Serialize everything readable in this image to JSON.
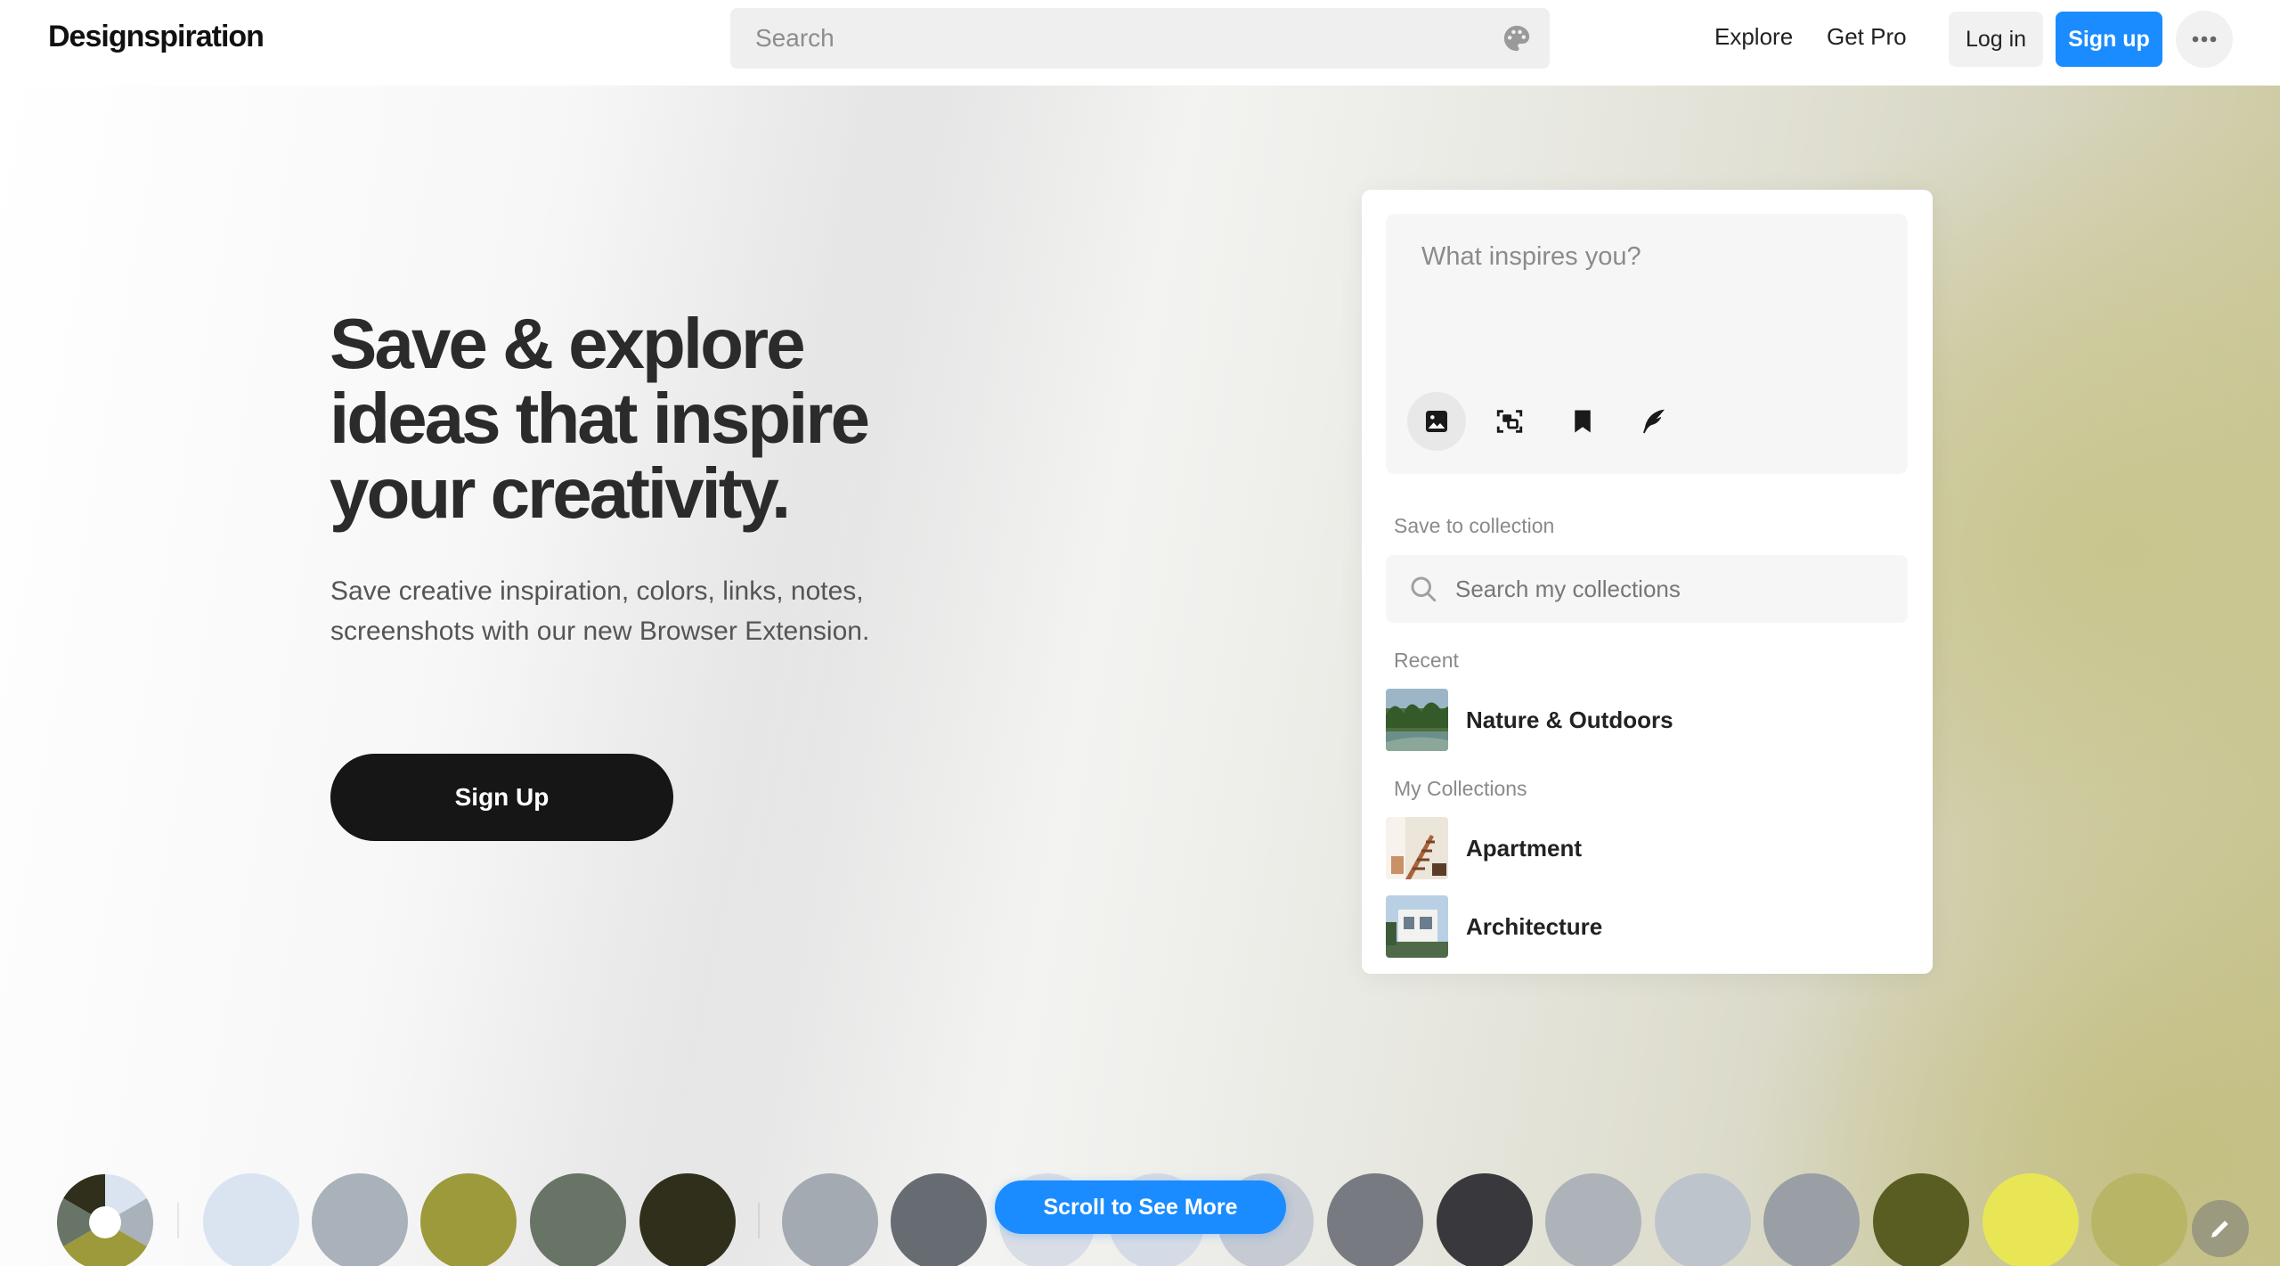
{
  "header": {
    "logo": "Designspiration",
    "search_placeholder": "Search",
    "nav": {
      "explore": "Explore",
      "get_pro": "Get Pro"
    },
    "login": "Log in",
    "signup": "Sign up",
    "more_icon": "more-horizontal-icon"
  },
  "hero": {
    "title": "Save & explore ideas that inspire your creativity.",
    "subtitle": "Save creative inspiration, colors, links, notes, screenshots with our new Browser Extension.",
    "cta": "Sign Up"
  },
  "card": {
    "compose_placeholder": "What inspires you?",
    "tools": [
      "image-icon",
      "screenshot-icon",
      "bookmark-icon",
      "quill-icon"
    ],
    "save_to_collection": "Save to collection",
    "collection_search_placeholder": "Search my collections",
    "recent_label": "Recent",
    "recent": [
      {
        "name": "Nature & Outdoors"
      }
    ],
    "my_collections_label": "My Collections",
    "collections": [
      {
        "name": "Apartment"
      },
      {
        "name": "Architecture"
      }
    ]
  },
  "swatches": {
    "group1": [
      "#d9e4f0",
      "#a9b1ba",
      "#9c9a3a",
      "#687466",
      "#2f2f1c"
    ],
    "group2": [
      "#a4aab2",
      "#676b72",
      "#d8dde6",
      "#d5dbe6",
      "#c5cad3",
      "#777a80",
      "#39393d",
      "#aeb3b9",
      "#bec4cc",
      "#9a9fa6",
      "#5a5d22",
      "#e8e655",
      "#b8b566"
    ]
  },
  "scroll_button": "Scroll to See More",
  "colors": {
    "accent": "#1a8cff",
    "dark": "#161616"
  }
}
